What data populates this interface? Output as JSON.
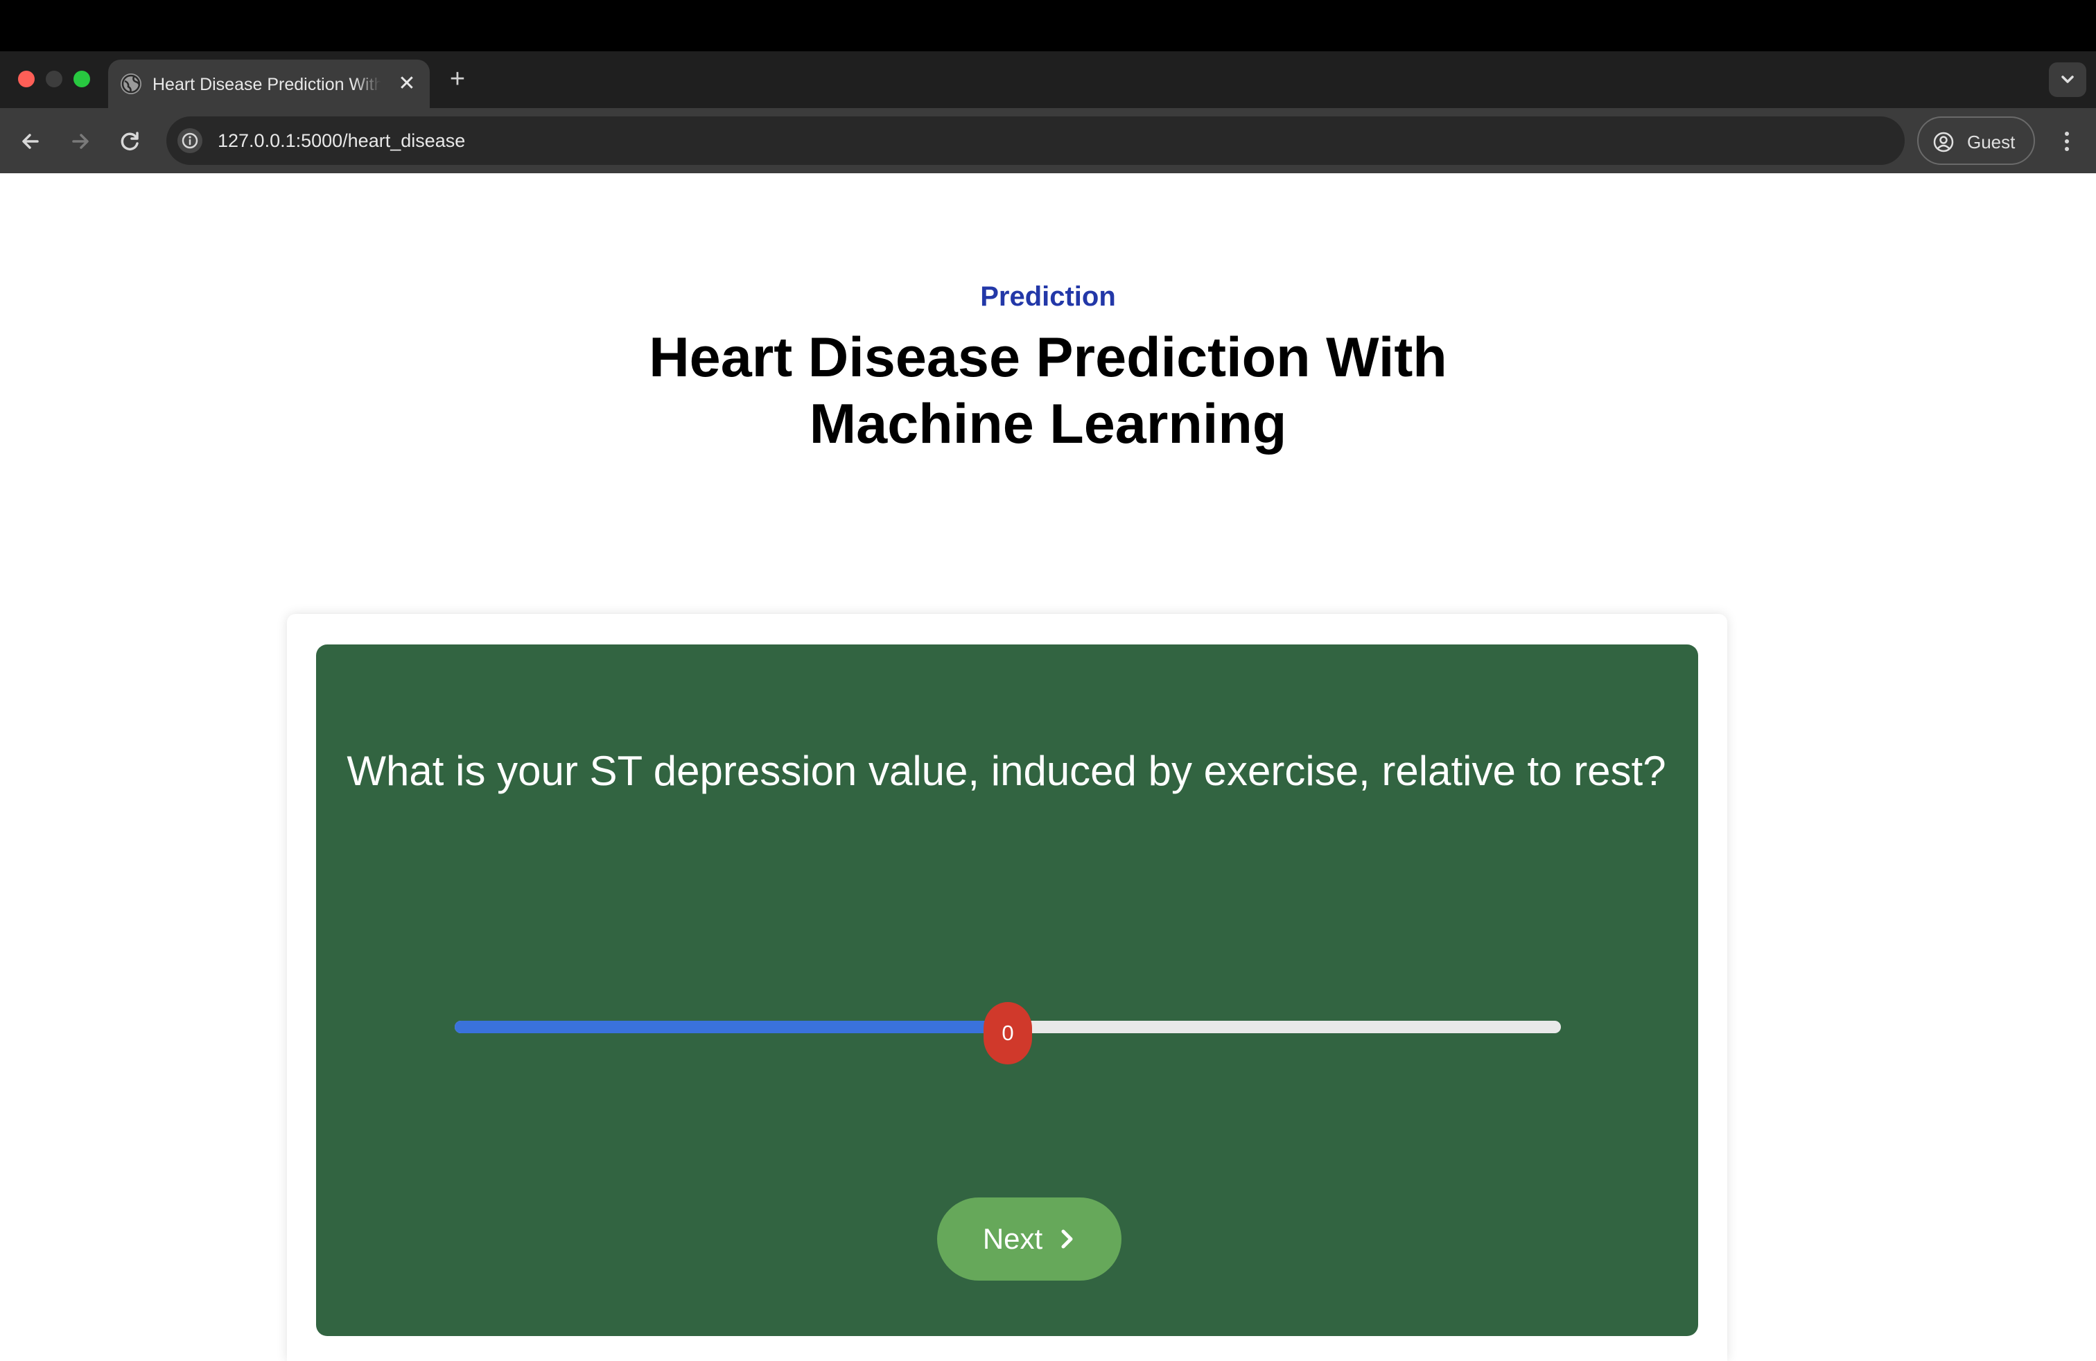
{
  "browser": {
    "tab_title": "Heart Disease Prediction With Machine Learning",
    "tab_close_glyph": "✕",
    "new_tab_glyph": "+",
    "url": "127.0.0.1:5000/heart_disease",
    "profile_label": "Guest",
    "icons": [
      "globe-icon",
      "close-icon",
      "plus-icon",
      "chevron-down-icon",
      "back-arrow-icon",
      "forward-arrow-icon",
      "reload-icon",
      "info-icon",
      "profile-icon",
      "kebab-menu-icon"
    ]
  },
  "page": {
    "kicker": "Prediction",
    "title": "Heart Disease Prediction With Machine Learning"
  },
  "quiz": {
    "question": "What is your ST depression value, induced by exercise, relative to rest?",
    "slider": {
      "value": "0",
      "fill_fraction": 0.5
    },
    "next_label": "Next",
    "next_icon": "chevron-right-icon"
  },
  "colors": {
    "kicker": "#2338a8",
    "panel": "#326441",
    "slider_fill": "#3a72db",
    "slider_thumb": "#d0392b",
    "next_button": "#66a85a"
  }
}
